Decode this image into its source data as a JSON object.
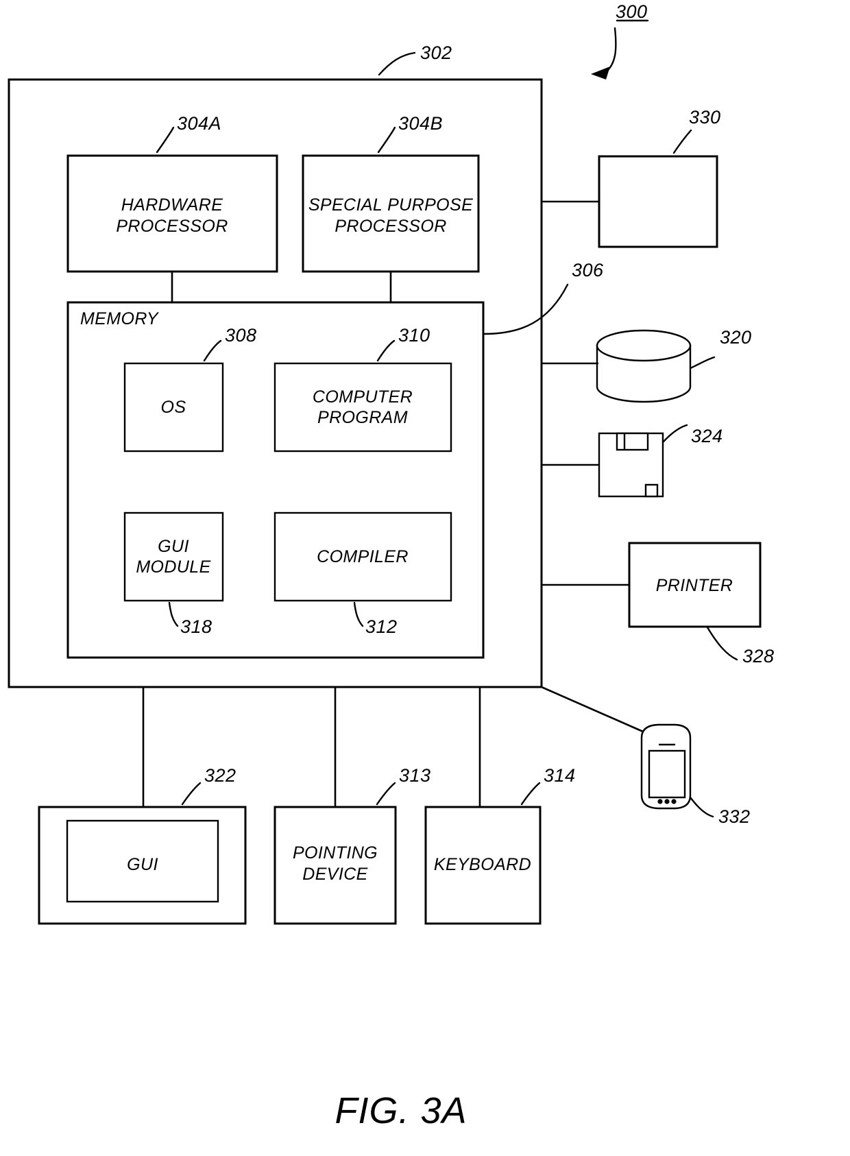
{
  "figure": {
    "caption": "FIG. 3A",
    "system_ref": "300"
  },
  "boxes": {
    "computer": {
      "label": "",
      "ref": "302"
    },
    "hardware_processor": {
      "label_line1": "HARDWARE",
      "label_line2": "PROCESSOR",
      "ref": "304A"
    },
    "special_purpose_processor": {
      "label_line1": "SPECIAL PURPOSE",
      "label_line2": "PROCESSOR",
      "ref": "304B"
    },
    "memory": {
      "label": "MEMORY",
      "ref": "306"
    },
    "os": {
      "label": "OS",
      "ref": "308"
    },
    "computer_program": {
      "label_line1": "COMPUTER",
      "label_line2": "PROGRAM",
      "ref": "310"
    },
    "gui_module": {
      "label_line1": "GUI",
      "label_line2": "MODULE",
      "ref": "318"
    },
    "compiler": {
      "label": "COMPILER",
      "ref": "312"
    },
    "unlabeled_peripheral": {
      "label": "",
      "ref": "330"
    },
    "data_storage": {
      "label": "",
      "ref": "320"
    },
    "removable_media": {
      "label": "",
      "ref": "324"
    },
    "printer": {
      "label": "PRINTER",
      "ref": "328"
    },
    "mobile_device": {
      "label": "",
      "ref": "332"
    },
    "gui": {
      "label": "GUI",
      "ref": "322"
    },
    "pointing_device": {
      "label_line1": "POINTING",
      "label_line2": "DEVICE",
      "ref": "313"
    },
    "keyboard": {
      "label": "KEYBOARD",
      "ref": "314"
    }
  },
  "colors": {
    "stroke": "#000000",
    "background": "#ffffff"
  }
}
